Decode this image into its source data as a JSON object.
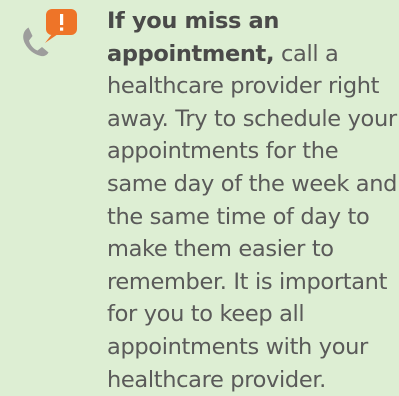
{
  "tip": {
    "lead": "If you miss an appointment,",
    "body": "call a healthcare provider right away. Try to schedule your appointments for the same day of the week and the same time of day to make them easier to remember. It is important for you to keep all appointments with your healthcare provider."
  },
  "icon": {
    "name": "phone-alert-icon",
    "badge_glyph": "!",
    "badge_color": "#ee7428",
    "phone_color": "#9d9d9c",
    "background_color": "#ddeed3"
  }
}
